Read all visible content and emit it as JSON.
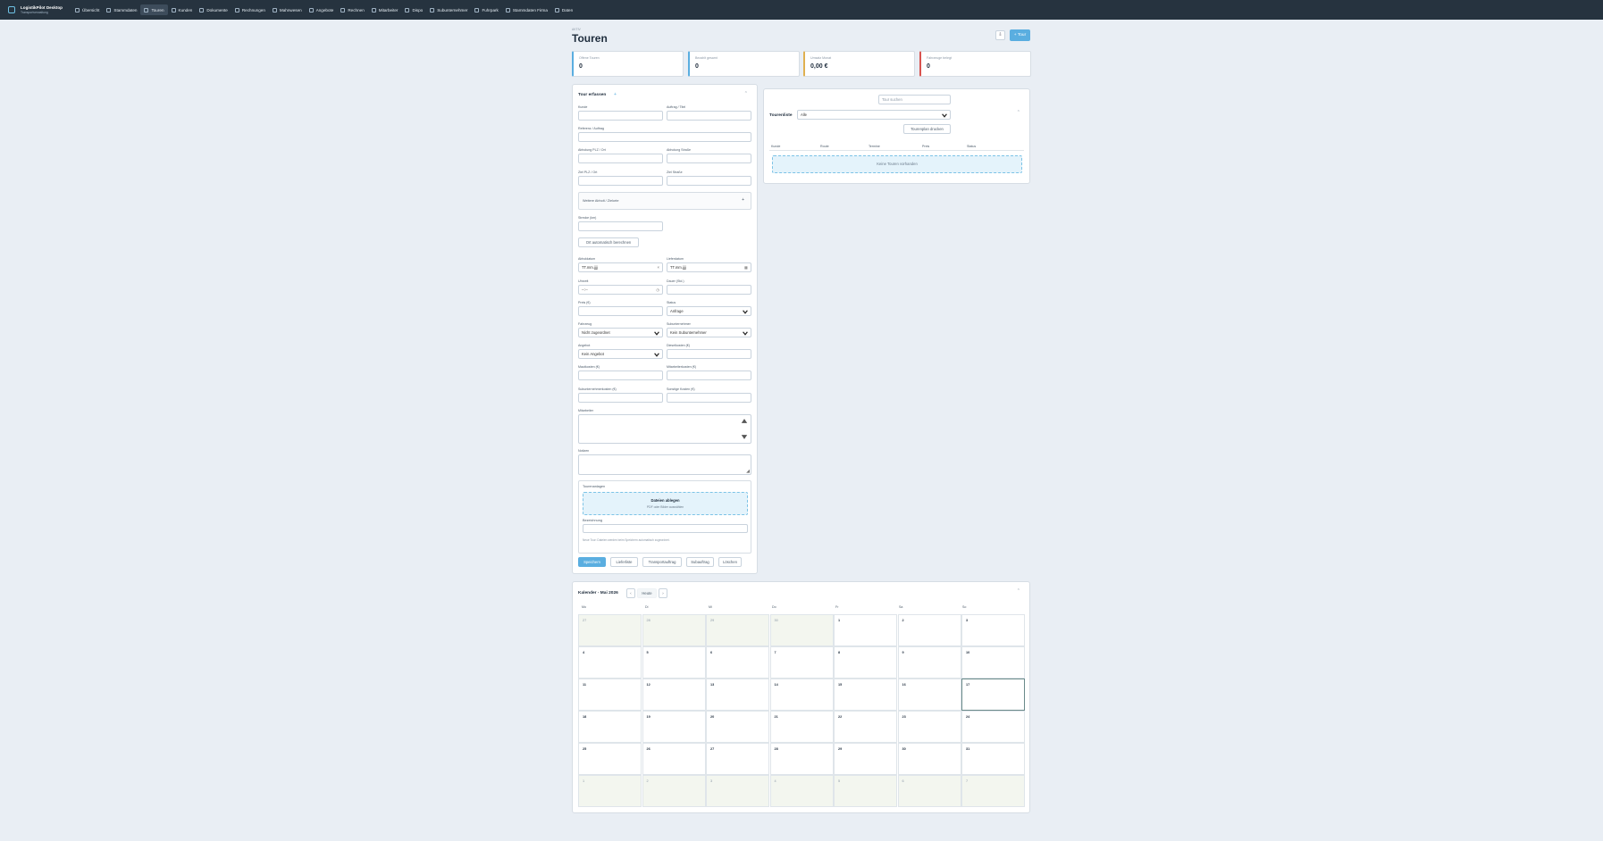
{
  "app": {
    "title": "LogistikPilot Desktop",
    "subtitle": "Transportverwaltung"
  },
  "nav": [
    {
      "label": "Übersicht",
      "active": false
    },
    {
      "label": "Stammdaten",
      "active": false
    },
    {
      "label": "Touren",
      "active": true
    },
    {
      "label": "Kunden",
      "active": false
    },
    {
      "label": "Dokumente",
      "active": false
    },
    {
      "label": "Rechnungen",
      "active": false
    },
    {
      "label": "Mahnwesen",
      "active": false
    },
    {
      "label": "Angebote",
      "active": false
    },
    {
      "label": "Rechnen",
      "active": false
    },
    {
      "label": "Mitarbeiter",
      "active": false
    },
    {
      "label": "Dispo",
      "active": false
    },
    {
      "label": "Subunternehmer",
      "active": false
    },
    {
      "label": "Fuhrpark",
      "active": false
    },
    {
      "label": "Stammdaten Firma",
      "active": false
    },
    {
      "label": "Daten",
      "active": false
    }
  ],
  "page": {
    "eyebrow": "Aktiv",
    "title": "Touren",
    "icon_button": "⇩",
    "new_button": "+ Tour"
  },
  "stats": [
    {
      "label": "Offene Touren",
      "value": "0",
      "accent": "#5aaee0"
    },
    {
      "label": "Bezahlt gesamt",
      "value": "0",
      "accent": "#5aaee0"
    },
    {
      "label": "Umsatz Monat",
      "value": "0,00 €",
      "accent": "#e0b050"
    },
    {
      "label": "Fahrzeuge belegt",
      "value": "0",
      "accent": "#d9534f"
    }
  ],
  "form": {
    "title": "Tour erfassen",
    "kunde_label": "Kunde",
    "auftrag_label": "Auftrag / Titel",
    "referenz_label": "Referenz / Auftrag",
    "abholung_plz_label": "Abholung PLZ / Ort",
    "abholung_strasse_label": "Abholung Straße",
    "ziel_plz_label": "Ziel PLZ / Ort",
    "ziel_strasse_label": "Ziel Straße",
    "weitere_label": "Weitere Abholt / Zielorte",
    "weitere_plus": "+",
    "strecke_label": "Strecke (km)",
    "auto_btn": "Ort automatisch berechnen",
    "abholdatum_label": "Abholdatum",
    "abholdatum_value": "TT.mm.jjjj",
    "lieferdatum_label": "Lieferdatum",
    "lieferdatum_value": "TT.mm.jjjj",
    "uhrzeit_label": "Uhrzeit",
    "uhrzeit_value": "--:--",
    "dauer_label": "Dauer (Std.)",
    "preis_label": "Preis (€)",
    "status_label": "Status",
    "status_value": "Anfrage",
    "fahrzeug_label": "Fahrzeug",
    "fahrzeug_value": "Nicht zugeordnet",
    "sub_label": "Subunternehmer",
    "sub_value": "Kein Subunternehmer",
    "angebot_label": "Angebot",
    "angebot_value": "Kein Angebot",
    "dieselkosten_label": "Dieselkosten (€)",
    "mautkosten_label": "Mautkosten (€)",
    "mitarbeiterkosten_label": "Mitarbeiterkosten (€)",
    "subkosten_label": "Subunternehmerkosten (€)",
    "sonstige_label": "Sonstige Kosten (€)",
    "mitarbeiter_label": "Mitarbeiter",
    "notizen_label": "Notizen",
    "anlagen_label": "Tourenanlagen",
    "drop_title": "Dateien ablegen",
    "drop_sub": "PDF oder Bilder auswählen",
    "bezeichnung_label": "Bezeichnung",
    "hint": "Neue Tour: Dateien werden beim Speichern automatisch zugeordnet.",
    "buttons": [
      "Speichern",
      "Lieferliste",
      "Transportauftrag",
      "Subauftrag",
      "Löschen"
    ]
  },
  "tourlist": {
    "search_placeholder": "Tour suchen",
    "label": "Tourenliste",
    "filter_value": "Alle",
    "template_btn": "Tourenplan drucken",
    "columns": [
      "Kunde",
      "Route",
      "Termine",
      "Preis",
      "Status"
    ],
    "empty": "Keine Touren vorhanden"
  },
  "calendar": {
    "title": "Kalender - Mai 2026",
    "prev": "‹",
    "today": "Heute",
    "next": "›",
    "weekdays": [
      "Mo",
      "Di",
      "Mi",
      "Do",
      "Fr",
      "Sa",
      "So"
    ],
    "days": [
      {
        "d": "27",
        "other": true
      },
      {
        "d": "28",
        "other": true
      },
      {
        "d": "29",
        "other": true
      },
      {
        "d": "30",
        "other": true
      },
      {
        "d": "1",
        "other": false
      },
      {
        "d": "2",
        "other": false
      },
      {
        "d": "3",
        "other": false
      },
      {
        "d": "4",
        "other": false
      },
      {
        "d": "5",
        "other": false
      },
      {
        "d": "6",
        "other": false
      },
      {
        "d": "7",
        "other": false
      },
      {
        "d": "8",
        "other": false
      },
      {
        "d": "9",
        "other": false
      },
      {
        "d": "10",
        "other": false
      },
      {
        "d": "11",
        "other": false
      },
      {
        "d": "12",
        "other": false
      },
      {
        "d": "13",
        "other": false
      },
      {
        "d": "14",
        "other": false
      },
      {
        "d": "15",
        "other": false
      },
      {
        "d": "16",
        "other": false
      },
      {
        "d": "17",
        "other": false,
        "today": true
      },
      {
        "d": "18",
        "other": false
      },
      {
        "d": "19",
        "other": false
      },
      {
        "d": "20",
        "other": false
      },
      {
        "d": "21",
        "other": false
      },
      {
        "d": "22",
        "other": false
      },
      {
        "d": "23",
        "other": false
      },
      {
        "d": "24",
        "other": false
      },
      {
        "d": "25",
        "other": false
      },
      {
        "d": "26",
        "other": false
      },
      {
        "d": "27",
        "other": false
      },
      {
        "d": "28",
        "other": false
      },
      {
        "d": "29",
        "other": false
      },
      {
        "d": "30",
        "other": false
      },
      {
        "d": "31",
        "other": false
      },
      {
        "d": "1",
        "other": true
      },
      {
        "d": "2",
        "other": true
      },
      {
        "d": "3",
        "other": true
      },
      {
        "d": "4",
        "other": true
      },
      {
        "d": "5",
        "other": true
      },
      {
        "d": "6",
        "other": true
      },
      {
        "d": "7",
        "other": true
      }
    ]
  }
}
